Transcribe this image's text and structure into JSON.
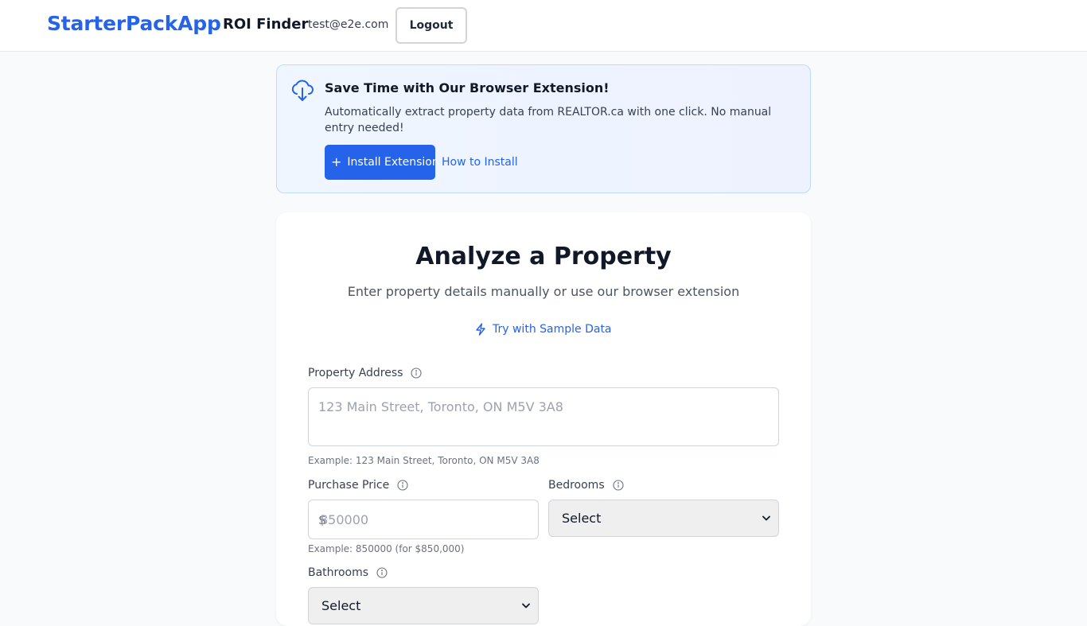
{
  "header": {
    "brand": "StarterPackApp",
    "subtitle": "ROI Finder",
    "user_email": "test@e2e.com",
    "logout_label": "Logout"
  },
  "banner": {
    "title": "Save Time with Our Browser Extension!",
    "text": "Automatically extract property data from REALTOR.ca with one click. No manual entry needed!",
    "install_label": "Install Extension",
    "install_icon": "+",
    "how_label": "How to Install"
  },
  "card": {
    "title": "Analyze a Property",
    "subtitle": "Enter property details manually or use our browser extension",
    "sample_label": "Try with Sample Data"
  },
  "form": {
    "address": {
      "label": "Property Address",
      "placeholder": "123 Main Street, Toronto, ON M5V 3A8",
      "value": "",
      "hint": "Example: 123 Main Street, Toronto, ON M5V 3A8"
    },
    "price": {
      "label": "Purchase Price",
      "prefix": "$",
      "placeholder": "850000",
      "value": "",
      "hint": "Example: 850000 (for $850,000)"
    },
    "bedrooms": {
      "label": "Bedrooms",
      "selected": "Select"
    },
    "bathrooms": {
      "label": "Bathrooms",
      "selected": "Select"
    }
  },
  "colors": {
    "brand": "#2563eb",
    "banner_border": "#bfdbfe",
    "background": "#f8fafc"
  },
  "icons": {
    "banner": "cloud-download-icon",
    "sample": "lightning-icon",
    "info": "info-icon",
    "select": "chevron-down-icon"
  }
}
